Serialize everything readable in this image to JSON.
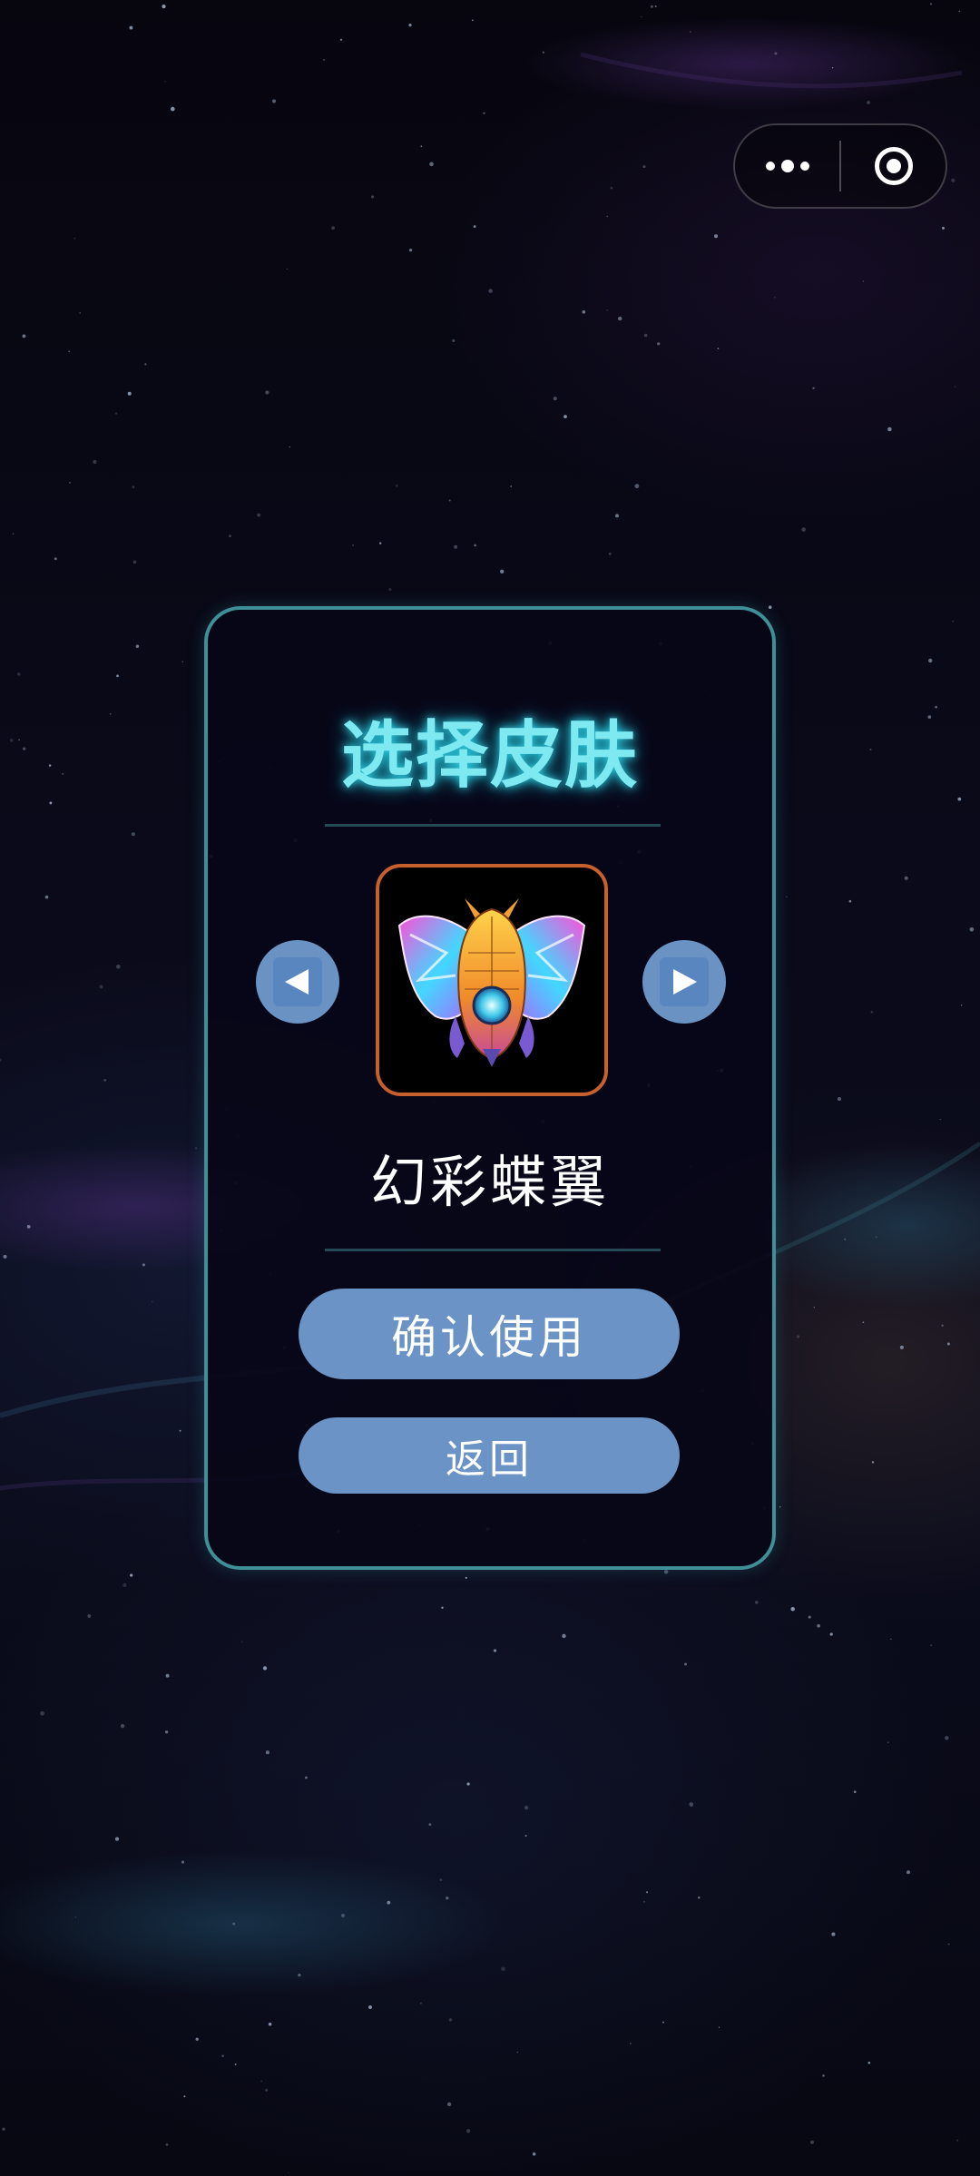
{
  "capsule": {
    "more_icon": "more-dots-icon",
    "close_icon": "target-circle-icon"
  },
  "dialog": {
    "title": "选择皮肤",
    "prev_icon": "triangle-left-icon",
    "next_icon": "triangle-right-icon",
    "skin_name": "幻彩蝶翼",
    "confirm_label": "确认使用",
    "back_label": "返回"
  },
  "colors": {
    "title": "#7fe9f2",
    "panel_border": "#3f8f96",
    "button": "#6b93c5",
    "skin_frame": "#c7602c"
  }
}
